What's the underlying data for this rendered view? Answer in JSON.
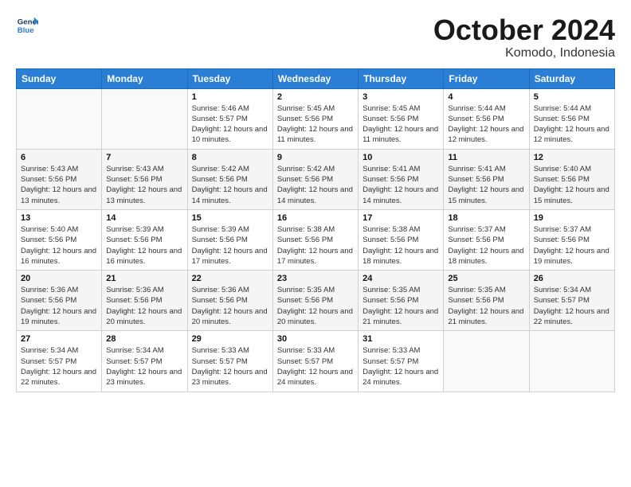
{
  "logo": {
    "line1": "General",
    "line2": "Blue"
  },
  "title": "October 2024",
  "location": "Komodo, Indonesia",
  "days_header": [
    "Sunday",
    "Monday",
    "Tuesday",
    "Wednesday",
    "Thursday",
    "Friday",
    "Saturday"
  ],
  "weeks": [
    [
      {
        "day": "",
        "sunrise": "",
        "sunset": "",
        "daylight": ""
      },
      {
        "day": "",
        "sunrise": "",
        "sunset": "",
        "daylight": ""
      },
      {
        "day": "1",
        "sunrise": "Sunrise: 5:46 AM",
        "sunset": "Sunset: 5:57 PM",
        "daylight": "Daylight: 12 hours and 10 minutes."
      },
      {
        "day": "2",
        "sunrise": "Sunrise: 5:45 AM",
        "sunset": "Sunset: 5:56 PM",
        "daylight": "Daylight: 12 hours and 11 minutes."
      },
      {
        "day": "3",
        "sunrise": "Sunrise: 5:45 AM",
        "sunset": "Sunset: 5:56 PM",
        "daylight": "Daylight: 12 hours and 11 minutes."
      },
      {
        "day": "4",
        "sunrise": "Sunrise: 5:44 AM",
        "sunset": "Sunset: 5:56 PM",
        "daylight": "Daylight: 12 hours and 12 minutes."
      },
      {
        "day": "5",
        "sunrise": "Sunrise: 5:44 AM",
        "sunset": "Sunset: 5:56 PM",
        "daylight": "Daylight: 12 hours and 12 minutes."
      }
    ],
    [
      {
        "day": "6",
        "sunrise": "Sunrise: 5:43 AM",
        "sunset": "Sunset: 5:56 PM",
        "daylight": "Daylight: 12 hours and 13 minutes."
      },
      {
        "day": "7",
        "sunrise": "Sunrise: 5:43 AM",
        "sunset": "Sunset: 5:56 PM",
        "daylight": "Daylight: 12 hours and 13 minutes."
      },
      {
        "day": "8",
        "sunrise": "Sunrise: 5:42 AM",
        "sunset": "Sunset: 5:56 PM",
        "daylight": "Daylight: 12 hours and 14 minutes."
      },
      {
        "day": "9",
        "sunrise": "Sunrise: 5:42 AM",
        "sunset": "Sunset: 5:56 PM",
        "daylight": "Daylight: 12 hours and 14 minutes."
      },
      {
        "day": "10",
        "sunrise": "Sunrise: 5:41 AM",
        "sunset": "Sunset: 5:56 PM",
        "daylight": "Daylight: 12 hours and 14 minutes."
      },
      {
        "day": "11",
        "sunrise": "Sunrise: 5:41 AM",
        "sunset": "Sunset: 5:56 PM",
        "daylight": "Daylight: 12 hours and 15 minutes."
      },
      {
        "day": "12",
        "sunrise": "Sunrise: 5:40 AM",
        "sunset": "Sunset: 5:56 PM",
        "daylight": "Daylight: 12 hours and 15 minutes."
      }
    ],
    [
      {
        "day": "13",
        "sunrise": "Sunrise: 5:40 AM",
        "sunset": "Sunset: 5:56 PM",
        "daylight": "Daylight: 12 hours and 16 minutes."
      },
      {
        "day": "14",
        "sunrise": "Sunrise: 5:39 AM",
        "sunset": "Sunset: 5:56 PM",
        "daylight": "Daylight: 12 hours and 16 minutes."
      },
      {
        "day": "15",
        "sunrise": "Sunrise: 5:39 AM",
        "sunset": "Sunset: 5:56 PM",
        "daylight": "Daylight: 12 hours and 17 minutes."
      },
      {
        "day": "16",
        "sunrise": "Sunrise: 5:38 AM",
        "sunset": "Sunset: 5:56 PM",
        "daylight": "Daylight: 12 hours and 17 minutes."
      },
      {
        "day": "17",
        "sunrise": "Sunrise: 5:38 AM",
        "sunset": "Sunset: 5:56 PM",
        "daylight": "Daylight: 12 hours and 18 minutes."
      },
      {
        "day": "18",
        "sunrise": "Sunrise: 5:37 AM",
        "sunset": "Sunset: 5:56 PM",
        "daylight": "Daylight: 12 hours and 18 minutes."
      },
      {
        "day": "19",
        "sunrise": "Sunrise: 5:37 AM",
        "sunset": "Sunset: 5:56 PM",
        "daylight": "Daylight: 12 hours and 19 minutes."
      }
    ],
    [
      {
        "day": "20",
        "sunrise": "Sunrise: 5:36 AM",
        "sunset": "Sunset: 5:56 PM",
        "daylight": "Daylight: 12 hours and 19 minutes."
      },
      {
        "day": "21",
        "sunrise": "Sunrise: 5:36 AM",
        "sunset": "Sunset: 5:56 PM",
        "daylight": "Daylight: 12 hours and 20 minutes."
      },
      {
        "day": "22",
        "sunrise": "Sunrise: 5:36 AM",
        "sunset": "Sunset: 5:56 PM",
        "daylight": "Daylight: 12 hours and 20 minutes."
      },
      {
        "day": "23",
        "sunrise": "Sunrise: 5:35 AM",
        "sunset": "Sunset: 5:56 PM",
        "daylight": "Daylight: 12 hours and 20 minutes."
      },
      {
        "day": "24",
        "sunrise": "Sunrise: 5:35 AM",
        "sunset": "Sunset: 5:56 PM",
        "daylight": "Daylight: 12 hours and 21 minutes."
      },
      {
        "day": "25",
        "sunrise": "Sunrise: 5:35 AM",
        "sunset": "Sunset: 5:56 PM",
        "daylight": "Daylight: 12 hours and 21 minutes."
      },
      {
        "day": "26",
        "sunrise": "Sunrise: 5:34 AM",
        "sunset": "Sunset: 5:57 PM",
        "daylight": "Daylight: 12 hours and 22 minutes."
      }
    ],
    [
      {
        "day": "27",
        "sunrise": "Sunrise: 5:34 AM",
        "sunset": "Sunset: 5:57 PM",
        "daylight": "Daylight: 12 hours and 22 minutes."
      },
      {
        "day": "28",
        "sunrise": "Sunrise: 5:34 AM",
        "sunset": "Sunset: 5:57 PM",
        "daylight": "Daylight: 12 hours and 23 minutes."
      },
      {
        "day": "29",
        "sunrise": "Sunrise: 5:33 AM",
        "sunset": "Sunset: 5:57 PM",
        "daylight": "Daylight: 12 hours and 23 minutes."
      },
      {
        "day": "30",
        "sunrise": "Sunrise: 5:33 AM",
        "sunset": "Sunset: 5:57 PM",
        "daylight": "Daylight: 12 hours and 24 minutes."
      },
      {
        "day": "31",
        "sunrise": "Sunrise: 5:33 AM",
        "sunset": "Sunset: 5:57 PM",
        "daylight": "Daylight: 12 hours and 24 minutes."
      },
      {
        "day": "",
        "sunrise": "",
        "sunset": "",
        "daylight": ""
      },
      {
        "day": "",
        "sunrise": "",
        "sunset": "",
        "daylight": ""
      }
    ]
  ]
}
